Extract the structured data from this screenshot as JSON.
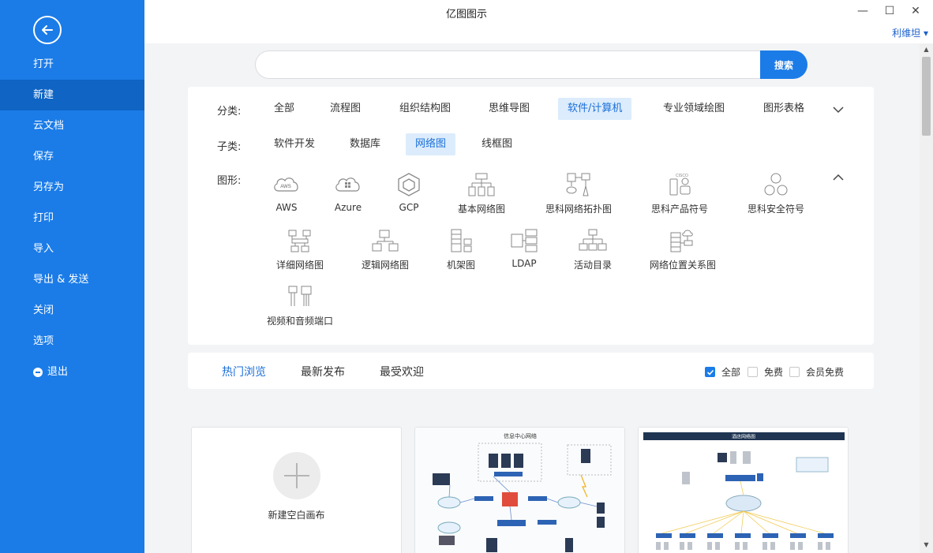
{
  "window": {
    "title": "亿图图示",
    "user": "利维坦 ▾",
    "minimize": "—",
    "maximize": "☐",
    "close": "✕"
  },
  "sidebar": {
    "items": [
      {
        "label": "打开"
      },
      {
        "label": "新建",
        "active": true
      },
      {
        "label": "云文档"
      },
      {
        "label": "保存"
      },
      {
        "label": "另存为"
      },
      {
        "label": "打印"
      },
      {
        "label": "导入"
      },
      {
        "label": "导出 & 发送"
      },
      {
        "label": "关闭"
      },
      {
        "label": "选项"
      },
      {
        "label": "退出",
        "icon": "exit-icon"
      }
    ],
    "color": "#1b7ce8",
    "active_color": "#0f64c4"
  },
  "search": {
    "placeholder": "",
    "button": "搜索"
  },
  "filters": {
    "category_label": "分类:",
    "categories": [
      "全部",
      "流程图",
      "组织结构图",
      "思维导图",
      "软件/计算机",
      "专业领域绘图",
      "图形表格"
    ],
    "active_category": "软件/计算机",
    "subcategory_label": "子类:",
    "subcategories": [
      "软件开发",
      "数据库",
      "网络图",
      "线框图"
    ],
    "active_subcategory": "网络图",
    "shapes_label": "图形:",
    "shapes": [
      {
        "label": "AWS",
        "icon": "aws-cloud-icon"
      },
      {
        "label": "Azure",
        "icon": "azure-cloud-icon"
      },
      {
        "label": "GCP",
        "icon": "gcp-hexagon-icon"
      },
      {
        "label": "基本网络图",
        "icon": "basic-network-icon"
      },
      {
        "label": "思科网络拓扑图",
        "icon": "cisco-topology-icon"
      },
      {
        "label": "思科产品符号",
        "icon": "cisco-product-icon"
      },
      {
        "label": "思科安全符号",
        "icon": "cisco-security-icon"
      },
      {
        "label": "详细网络图",
        "icon": "detailed-network-icon"
      },
      {
        "label": "逻辑网络图",
        "icon": "logical-network-icon"
      },
      {
        "label": "机架图",
        "icon": "rack-icon"
      },
      {
        "label": "LDAP",
        "icon": "ldap-icon"
      },
      {
        "label": "活动目录",
        "icon": "active-directory-icon"
      },
      {
        "label": "网络位置关系图",
        "icon": "network-location-icon"
      },
      {
        "label": "视频和音频端口",
        "icon": "av-ports-icon"
      }
    ]
  },
  "tabs": {
    "items": [
      "热门浏览",
      "最新发布",
      "最受欢迎"
    ],
    "active": "热门浏览",
    "checkboxes": [
      {
        "label": "全部",
        "checked": true
      },
      {
        "label": "免费",
        "checked": false
      },
      {
        "label": "会员免费",
        "checked": false
      }
    ]
  },
  "cards": {
    "new_blank": "新建空白画布",
    "template1_title": "信息中心网络",
    "template2_title": "酒店网络图"
  },
  "accent": "#1b7ce8"
}
